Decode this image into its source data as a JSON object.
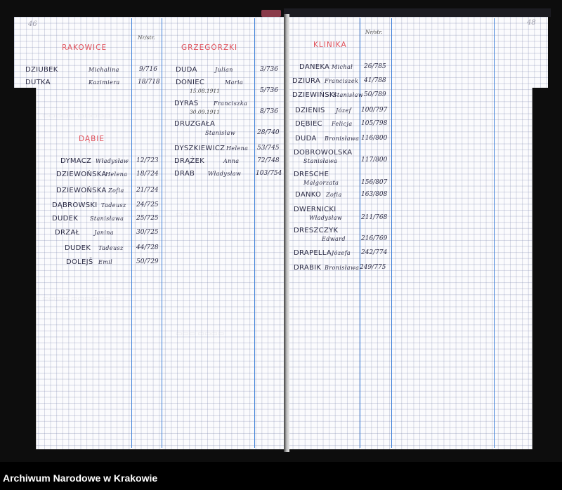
{
  "footer": {
    "archive_name": "Archiwum Narodowe w Krakowie"
  },
  "left_page": {
    "page_number": "46",
    "col_header": "Nr/str.",
    "sections": [
      {
        "title": "RAKOWICE",
        "entries": [
          {
            "surname": "DZIUBEK",
            "given": "Michalina",
            "num": "9/716"
          },
          {
            "surname": "DUTKA",
            "given": "Kazimiera",
            "num": "18/718"
          }
        ]
      },
      {
        "title": "DĄBIE",
        "entries": [
          {
            "surname": "DYMACZ",
            "given": "Władysław",
            "num": "12/723"
          },
          {
            "surname": "DZIEWOŃSKA",
            "given": "Helena",
            "num": "18/724"
          },
          {
            "surname": "DZIEWOŃSKA",
            "given": "Zofia",
            "num": "21/724"
          },
          {
            "surname": "DĄBROWSKI",
            "given": "Tadeusz",
            "num": "24/725"
          },
          {
            "surname": "DUDEK",
            "given": "Stanisława",
            "num": "25/725"
          },
          {
            "surname": "DRZAŁ",
            "given": "Janina",
            "num": "30/725"
          },
          {
            "surname": "DUDEK",
            "given": "Tadeusz",
            "num": "44/728"
          },
          {
            "surname": "DOLEJŠ",
            "given": "Emil",
            "num": "50/729"
          }
        ]
      },
      {
        "title": "GRZEGÓRZKI",
        "entries": [
          {
            "surname": "DUDA",
            "given": "Julian",
            "num": "3/736",
            "note": ""
          },
          {
            "surname": "DONIEC",
            "given": "Maria",
            "num": "5/736",
            "note": "15.08.1911"
          },
          {
            "surname": "DYRAS",
            "given": "Franciszka",
            "num": "8/736",
            "note": "30.09.1911"
          },
          {
            "surname": "DRUZGAŁA",
            "given": "Stanisław",
            "num": "28/740",
            "note": ""
          },
          {
            "surname": "DYSZKIEWICZ",
            "given": "Helena",
            "num": "53/745",
            "note": ""
          },
          {
            "surname": "DRĄŻEK",
            "given": "Anna",
            "num": "72/748",
            "note": ""
          },
          {
            "surname": "DRAB",
            "given": "Władysław",
            "num": "103/754",
            "note": ""
          }
        ]
      }
    ]
  },
  "right_page": {
    "page_number": "48",
    "col_header": "Nr/str.",
    "section_title": "KLINIKA",
    "entries": [
      {
        "surname": "DANEKA",
        "given": "Michał",
        "num": "26/785"
      },
      {
        "surname": "DZIURA",
        "given": "Franciszek",
        "num": "41/788"
      },
      {
        "surname": "DZIEWIŃSKI",
        "given": "Stanisław",
        "num": "50/789"
      },
      {
        "surname": "DZIENIS",
        "given": "Józef",
        "num": "100/797"
      },
      {
        "surname": "DĘBIEC",
        "given": "Felicja",
        "num": "105/798"
      },
      {
        "surname": "DUDA",
        "given": "Bronisława",
        "num": "116/800"
      },
      {
        "surname": "DOBROWOLSKA",
        "given": "Stanisława",
        "num": "117/800"
      },
      {
        "surname": "DRESCHE",
        "given": "Małgorzata",
        "num": "156/807"
      },
      {
        "surname": "DANKO",
        "given": "Zofia",
        "num": "163/808"
      },
      {
        "surname": "DWERNICKI",
        "given": "Władysław",
        "num": "211/768"
      },
      {
        "surname": "DRESZCZYK",
        "given": "Edward",
        "num": "216/769"
      },
      {
        "surname": "DRAPELLA",
        "given": "Józefa",
        "num": "242/774"
      },
      {
        "surname": "DRABIK",
        "given": "Bronisława",
        "num": "249/775"
      }
    ]
  },
  "colors": {
    "header_red": "#e0505a",
    "rule_blue": "#3d7fd8",
    "ink": "#2a2a44"
  }
}
